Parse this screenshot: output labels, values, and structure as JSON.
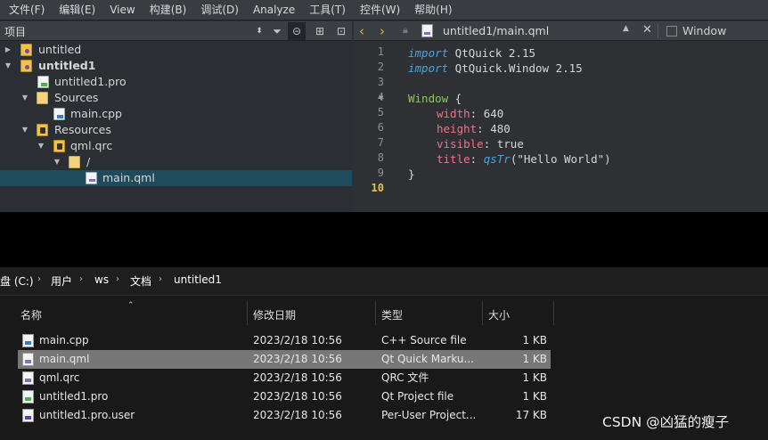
{
  "menu": [
    "文件(F)",
    "编辑(E)",
    "View",
    "构建(B)",
    "调试(D)",
    "Analyze",
    "工具(T)",
    "控件(W)",
    "帮助(H)"
  ],
  "project_panel": {
    "title": "项目",
    "tree": [
      {
        "label": "untitled",
        "bold": false
      },
      {
        "label": "untitled1",
        "bold": true
      },
      {
        "label": "untitled1.pro"
      },
      {
        "label": "Sources"
      },
      {
        "label": "main.cpp"
      },
      {
        "label": "Resources"
      },
      {
        "label": "qml.qrc"
      },
      {
        "label": "/"
      },
      {
        "label": "main.qml",
        "selected": true
      }
    ]
  },
  "editor": {
    "file_name": "untitled1/main.qml",
    "symbol_label": "Window",
    "line_numbers": [
      "1",
      "2",
      "3",
      "4",
      "5",
      "6",
      "7",
      "8",
      "9",
      "10"
    ],
    "current_line": "10",
    "code": {
      "l1_kw": "import",
      "l1_rest": " QtQuick 2.15",
      "l2_kw": "import",
      "l2_rest": " QtQuick.Window 2.15",
      "l4_type": "Window",
      "l4_rest": " {",
      "l5_prop": "width",
      "l5_rest": ": 640",
      "l6_prop": "height",
      "l6_rest": ": 480",
      "l7_prop": "visible",
      "l7_rest": ": true",
      "l8_prop": "title",
      "l8_sep": ": ",
      "l8_fn": "qsTr",
      "l8_rest": "(\"Hello World\")",
      "l9": "}"
    }
  },
  "explorer": {
    "breadcrumb": [
      "盘 (C:)",
      "用户",
      "ws",
      "文档",
      "untitled1"
    ],
    "columns": [
      "名称",
      "修改日期",
      "类型",
      "大小"
    ],
    "files": [
      {
        "name": "main.cpp",
        "date": "2023/2/18 10:56",
        "type": "C++ Source file",
        "size": "1 KB"
      },
      {
        "name": "main.qml",
        "date": "2023/2/18 10:56",
        "type": "Qt Quick Marku...",
        "size": "1 KB",
        "selected": true
      },
      {
        "name": "qml.qrc",
        "date": "2023/2/18 10:56",
        "type": "QRC 文件",
        "size": "1 KB"
      },
      {
        "name": "untitled1.pro",
        "date": "2023/2/18 10:56",
        "type": "Qt Project file",
        "size": "1 KB"
      },
      {
        "name": "untitled1.pro.user",
        "date": "2023/2/18 10:56",
        "type": "Per-User Project...",
        "size": "17 KB"
      }
    ]
  },
  "watermark": "CSDN @凶猛的瘦子"
}
